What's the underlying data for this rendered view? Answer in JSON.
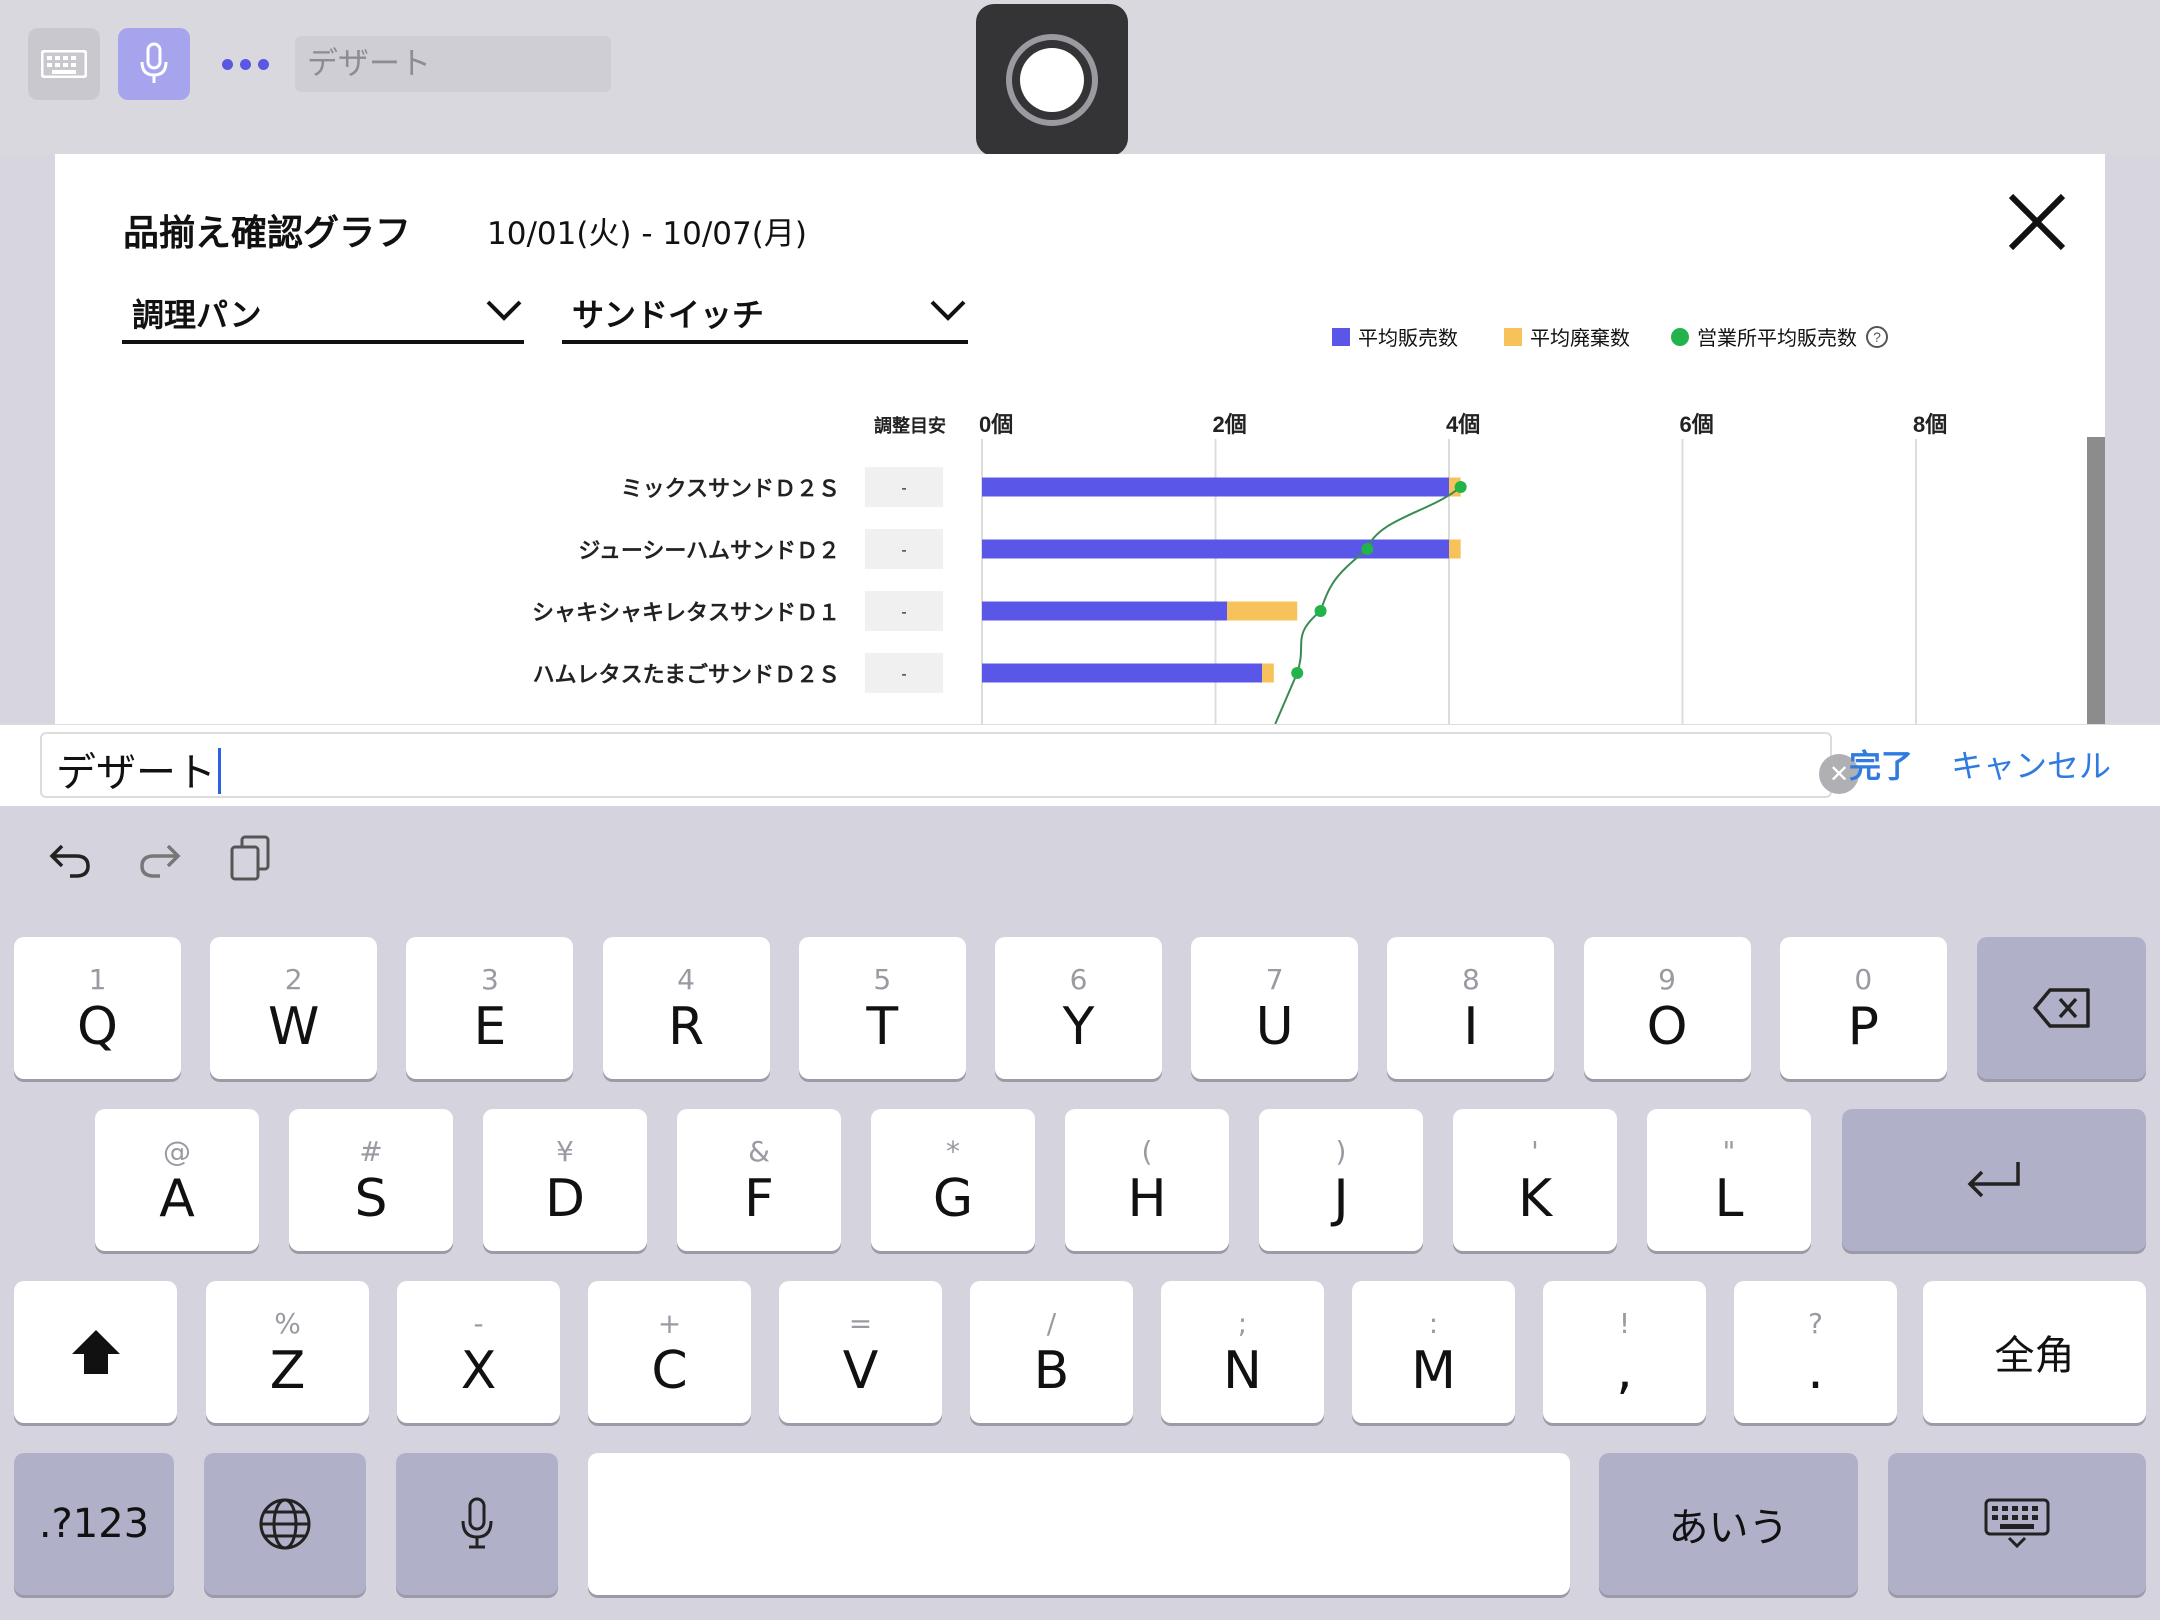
{
  "top_bar": {
    "search_text": "デザート"
  },
  "modal": {
    "title": "品揃え確認グラフ",
    "date_range": "10/01(火) - 10/07(月)",
    "dropdown_category": "調理パン",
    "dropdown_subcategory": "サンドイッチ",
    "legend": [
      {
        "label": "平均販売数",
        "color": "#5a57e8"
      },
      {
        "label": "平均廃棄数",
        "color": "#f7c25a"
      },
      {
        "label": "営業所平均販売数",
        "color": "#22b34a"
      }
    ],
    "adjust_header": "調整目安"
  },
  "chart_data": {
    "type": "bar",
    "stacked": true,
    "orientation": "horizontal",
    "categories": [
      "ミックスサンドＤ２Ｓ",
      "ジューシーハムサンドＤ２",
      "シャキシャキレタスサンドＤ１",
      "ハムレタスたまごサンドＤ２Ｓ"
    ],
    "adjust_values": [
      "-",
      "-",
      "-",
      "-"
    ],
    "x_ticks": [
      "0個",
      "2個",
      "4個",
      "6個",
      "8個"
    ],
    "xlim": [
      0,
      8.5
    ],
    "series": [
      {
        "name": "平均販売数",
        "values": [
          4.0,
          4.0,
          2.1,
          2.4
        ]
      },
      {
        "name": "平均廃棄数",
        "values": [
          0.1,
          0.1,
          0.6,
          0.1
        ]
      },
      {
        "name": "営業所平均販売数",
        "type": "line",
        "values": [
          4.1,
          3.3,
          2.9,
          2.7
        ]
      }
    ]
  },
  "entry": {
    "text": "デザート",
    "done_label": "完了",
    "cancel_label": "キャンセル"
  },
  "keyboard": {
    "rows": [
      [
        {
          "p": "Q",
          "s": "1"
        },
        {
          "p": "W",
          "s": "2"
        },
        {
          "p": "E",
          "s": "3"
        },
        {
          "p": "R",
          "s": "4"
        },
        {
          "p": "T",
          "s": "5"
        },
        {
          "p": "Y",
          "s": "6"
        },
        {
          "p": "U",
          "s": "7"
        },
        {
          "p": "I",
          "s": "8"
        },
        {
          "p": "O",
          "s": "9"
        },
        {
          "p": "P",
          "s": "0"
        }
      ],
      [
        {
          "p": "A",
          "s": "@"
        },
        {
          "p": "S",
          "s": "#"
        },
        {
          "p": "D",
          "s": "¥"
        },
        {
          "p": "F",
          "s": "&"
        },
        {
          "p": "G",
          "s": "*"
        },
        {
          "p": "H",
          "s": "("
        },
        {
          "p": "J",
          "s": ")"
        },
        {
          "p": "K",
          "s": "'"
        },
        {
          "p": "L",
          "s": "\""
        }
      ],
      [
        {
          "p": "Z",
          "s": "%"
        },
        {
          "p": "X",
          "s": "-"
        },
        {
          "p": "C",
          "s": "+"
        },
        {
          "p": "V",
          "s": "="
        },
        {
          "p": "B",
          "s": "/"
        },
        {
          "p": "N",
          "s": ";"
        },
        {
          "p": "M",
          "s": ":"
        },
        {
          "p": ",",
          "s": "!"
        },
        {
          "p": ".",
          "s": "?"
        }
      ]
    ],
    "wide_key_label": "全角",
    "numbers_label": ".?123",
    "kana_label": "あいう"
  }
}
